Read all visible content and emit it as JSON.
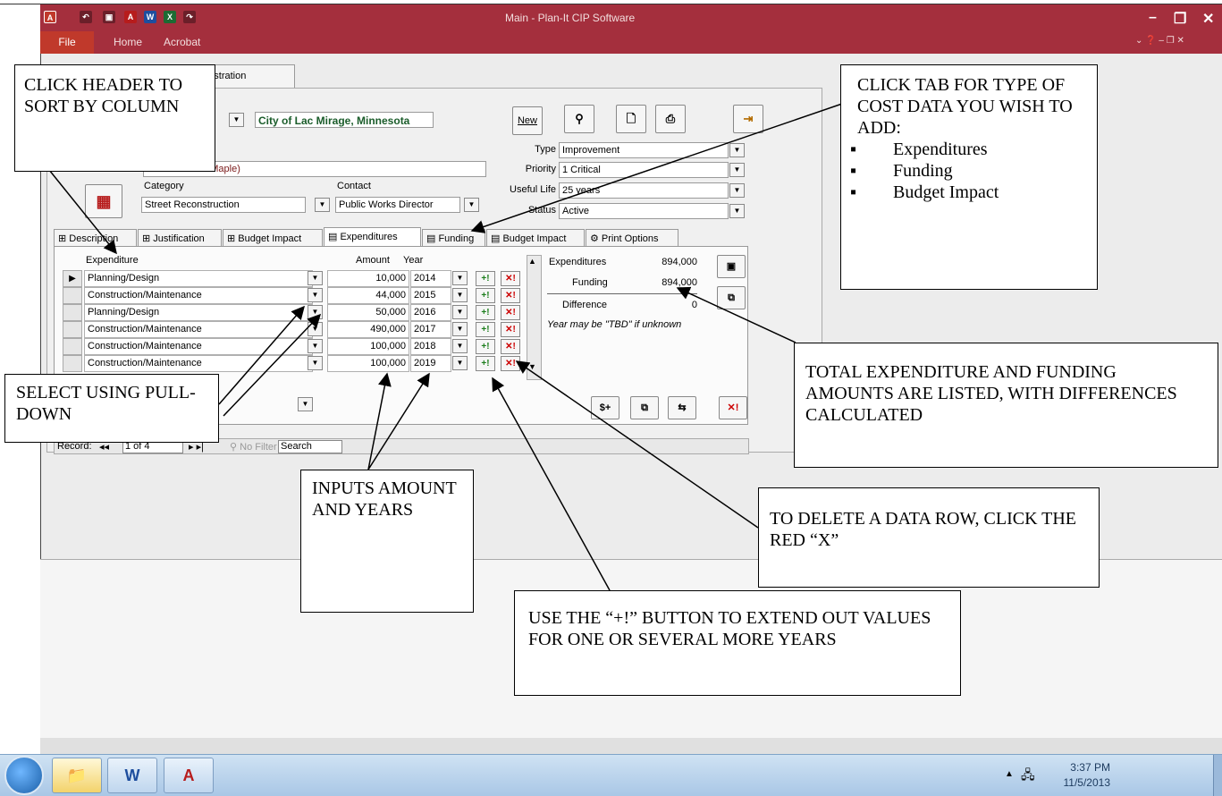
{
  "window": {
    "title": "Main - Plan-It CIP Software",
    "menu": [
      "File",
      "Home",
      "Acrobat"
    ]
  },
  "form": {
    "admin_tab": "dministration",
    "city": "City of Lac Mirage, Minnesota",
    "new_button": "New",
    "project_name_partial": "to Maple)",
    "category_label": "Category",
    "category_value": "Street Reconstruction",
    "contact_label": "Contact",
    "contact_value": "Public Works Director",
    "type_label": "Type",
    "type_value": "Improvement",
    "priority_label": "Priority",
    "priority_value": "1 Critical",
    "useful_life_label": "Useful Life",
    "useful_life_value": "25 years",
    "status_label": "Status",
    "status_value": "Active"
  },
  "tabs": [
    "Description",
    "Justification",
    "Budget Impact",
    "Expenditures",
    "Funding",
    "Budget Impact",
    "Print Options"
  ],
  "grid": {
    "headers": [
      "Expenditure",
      "Amount",
      "Year"
    ],
    "rows": [
      {
        "expenditure": "Planning/Design",
        "amount": "10,000",
        "year": "2014"
      },
      {
        "expenditure": "Construction/Maintenance",
        "amount": "44,000",
        "year": "2015"
      },
      {
        "expenditure": "Planning/Design",
        "amount": "50,000",
        "year": "2016"
      },
      {
        "expenditure": "Construction/Maintenance",
        "amount": "490,000",
        "year": "2017"
      },
      {
        "expenditure": "Construction/Maintenance",
        "amount": "100,000",
        "year": "2018"
      },
      {
        "expenditure": "Construction/Maintenance",
        "amount": "100,000",
        "year": "2019"
      }
    ]
  },
  "totals": {
    "expenditures_label": "Expenditures",
    "expenditures_value": "894,000",
    "funding_label": "Funding",
    "funding_value": "894,000",
    "difference_label": "Difference",
    "difference_value": "0",
    "note": "Year may be \"TBD\" if unknown"
  },
  "record_bar": {
    "record_label": "Record:",
    "position": "1 of 4",
    "filter": "No Filter",
    "search": "Search"
  },
  "callouts": {
    "sort": "CLICK HEADER TO SORT BY COLUMN",
    "tab_title": "CLICK TAB FOR TYPE OF COST DATA YOU WISH TO ADD:",
    "tab_items": [
      "Expenditures",
      "Funding",
      "Budget Impact"
    ],
    "totals": "TOTAL EXPENDITURE AND FUNDING AMOUNTS ARE LISTED, WITH DIFFERENCES CALCULATED",
    "pulldown": "SELECT USING PULL-DOWN",
    "inputs": "INPUTS AMOUNT AND YEARS",
    "delete": "TO DELETE A DATA ROW, CLICK THE RED “X”",
    "extend": "USE THE “+!” BUTTON TO EXTEND OUT VALUES FOR ONE OR SEVERAL MORE YEARS"
  },
  "taskbar": {
    "time": "3:37 PM",
    "date": "11/5/2013"
  },
  "colors": {
    "titlebar": "#a42f3d",
    "city_text": "#1a5c2a",
    "project_text": "#7a1a1a"
  }
}
